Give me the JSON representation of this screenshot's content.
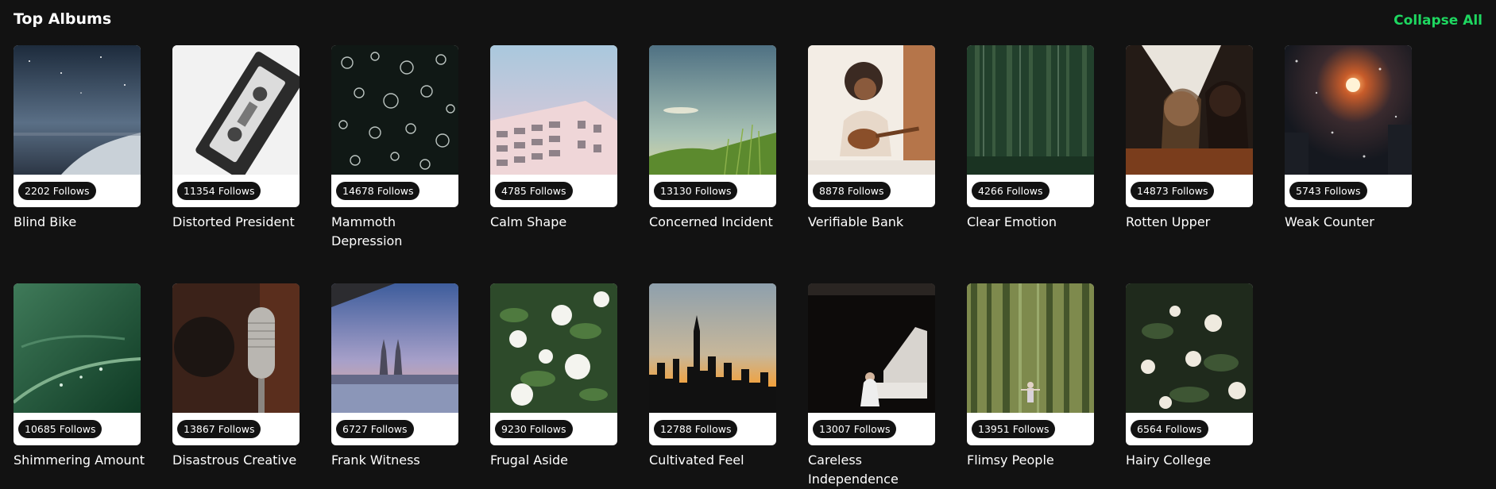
{
  "section": {
    "title": "Top Albums",
    "collapse_label": "Collapse All"
  },
  "accent_color": "#1ed760",
  "albums": [
    {
      "title": "Blind Bike",
      "follows": "2202 Follows",
      "art": "night-sky-icon"
    },
    {
      "title": "Distorted President",
      "follows": "11354 Follows",
      "art": "cassette-icon"
    },
    {
      "title": "Mammoth Depression",
      "follows": "14678 Follows",
      "art": "jellyfish-icon"
    },
    {
      "title": "Calm Shape",
      "follows": "4785 Follows",
      "art": "building-icon"
    },
    {
      "title": "Concerned Incident",
      "follows": "13130 Follows",
      "art": "grass-sky-icon"
    },
    {
      "title": "Verifiable Bank",
      "follows": "8878 Follows",
      "art": "child-guitar-icon"
    },
    {
      "title": "Clear Emotion",
      "follows": "4266 Follows",
      "art": "forest-icon"
    },
    {
      "title": "Rotten Upper",
      "follows": "14873 Follows",
      "art": "friends-icon"
    },
    {
      "title": "Weak Counter",
      "follows": "5743 Follows",
      "art": "snow-light-icon"
    },
    {
      "title": "Shimmering Amount",
      "follows": "10685 Follows",
      "art": "dewdrop-grass-icon"
    },
    {
      "title": "Disastrous Creative",
      "follows": "13867 Follows",
      "art": "microphone-icon"
    },
    {
      "title": "Frank Witness",
      "follows": "6727 Follows",
      "art": "city-towers-icon"
    },
    {
      "title": "Frugal Aside",
      "follows": "9230 Follows",
      "art": "white-roses-icon"
    },
    {
      "title": "Cultivated Feel",
      "follows": "12788 Follows",
      "art": "skyline-sunset-icon"
    },
    {
      "title": "Careless Independence",
      "follows": "13007 Follows",
      "art": "piano-icon"
    },
    {
      "title": "Flimsy People",
      "follows": "13951 Follows",
      "art": "bamboo-forest-icon"
    },
    {
      "title": "Hairy College",
      "follows": "6564 Follows",
      "art": "roses-dark-icon"
    }
  ]
}
